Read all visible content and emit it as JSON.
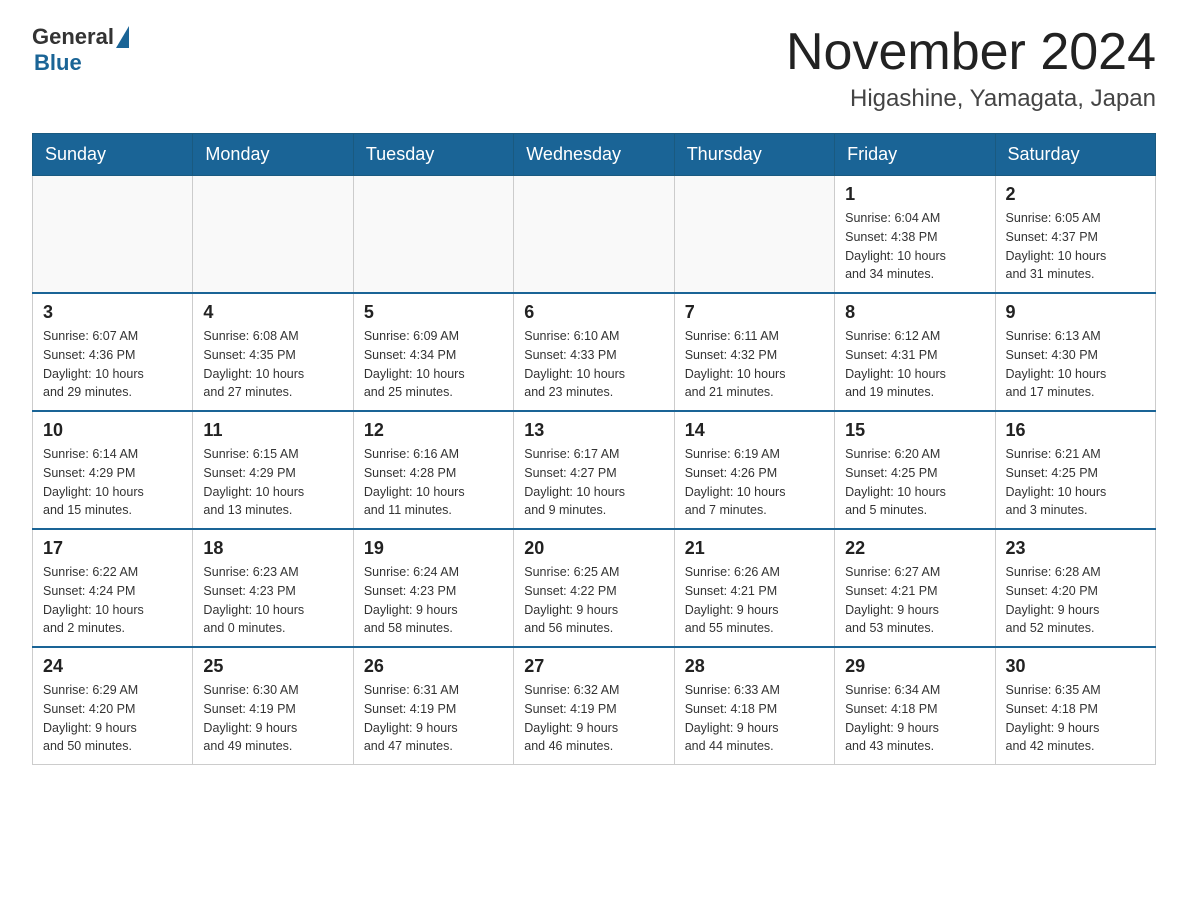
{
  "header": {
    "logo_general": "General",
    "logo_blue": "Blue",
    "title": "November 2024",
    "subtitle": "Higashine, Yamagata, Japan"
  },
  "days_of_week": [
    "Sunday",
    "Monday",
    "Tuesday",
    "Wednesday",
    "Thursday",
    "Friday",
    "Saturday"
  ],
  "weeks": [
    [
      {
        "day": "",
        "info": ""
      },
      {
        "day": "",
        "info": ""
      },
      {
        "day": "",
        "info": ""
      },
      {
        "day": "",
        "info": ""
      },
      {
        "day": "",
        "info": ""
      },
      {
        "day": "1",
        "info": "Sunrise: 6:04 AM\nSunset: 4:38 PM\nDaylight: 10 hours\nand 34 minutes."
      },
      {
        "day": "2",
        "info": "Sunrise: 6:05 AM\nSunset: 4:37 PM\nDaylight: 10 hours\nand 31 minutes."
      }
    ],
    [
      {
        "day": "3",
        "info": "Sunrise: 6:07 AM\nSunset: 4:36 PM\nDaylight: 10 hours\nand 29 minutes."
      },
      {
        "day": "4",
        "info": "Sunrise: 6:08 AM\nSunset: 4:35 PM\nDaylight: 10 hours\nand 27 minutes."
      },
      {
        "day": "5",
        "info": "Sunrise: 6:09 AM\nSunset: 4:34 PM\nDaylight: 10 hours\nand 25 minutes."
      },
      {
        "day": "6",
        "info": "Sunrise: 6:10 AM\nSunset: 4:33 PM\nDaylight: 10 hours\nand 23 minutes."
      },
      {
        "day": "7",
        "info": "Sunrise: 6:11 AM\nSunset: 4:32 PM\nDaylight: 10 hours\nand 21 minutes."
      },
      {
        "day": "8",
        "info": "Sunrise: 6:12 AM\nSunset: 4:31 PM\nDaylight: 10 hours\nand 19 minutes."
      },
      {
        "day": "9",
        "info": "Sunrise: 6:13 AM\nSunset: 4:30 PM\nDaylight: 10 hours\nand 17 minutes."
      }
    ],
    [
      {
        "day": "10",
        "info": "Sunrise: 6:14 AM\nSunset: 4:29 PM\nDaylight: 10 hours\nand 15 minutes."
      },
      {
        "day": "11",
        "info": "Sunrise: 6:15 AM\nSunset: 4:29 PM\nDaylight: 10 hours\nand 13 minutes."
      },
      {
        "day": "12",
        "info": "Sunrise: 6:16 AM\nSunset: 4:28 PM\nDaylight: 10 hours\nand 11 minutes."
      },
      {
        "day": "13",
        "info": "Sunrise: 6:17 AM\nSunset: 4:27 PM\nDaylight: 10 hours\nand 9 minutes."
      },
      {
        "day": "14",
        "info": "Sunrise: 6:19 AM\nSunset: 4:26 PM\nDaylight: 10 hours\nand 7 minutes."
      },
      {
        "day": "15",
        "info": "Sunrise: 6:20 AM\nSunset: 4:25 PM\nDaylight: 10 hours\nand 5 minutes."
      },
      {
        "day": "16",
        "info": "Sunrise: 6:21 AM\nSunset: 4:25 PM\nDaylight: 10 hours\nand 3 minutes."
      }
    ],
    [
      {
        "day": "17",
        "info": "Sunrise: 6:22 AM\nSunset: 4:24 PM\nDaylight: 10 hours\nand 2 minutes."
      },
      {
        "day": "18",
        "info": "Sunrise: 6:23 AM\nSunset: 4:23 PM\nDaylight: 10 hours\nand 0 minutes."
      },
      {
        "day": "19",
        "info": "Sunrise: 6:24 AM\nSunset: 4:23 PM\nDaylight: 9 hours\nand 58 minutes."
      },
      {
        "day": "20",
        "info": "Sunrise: 6:25 AM\nSunset: 4:22 PM\nDaylight: 9 hours\nand 56 minutes."
      },
      {
        "day": "21",
        "info": "Sunrise: 6:26 AM\nSunset: 4:21 PM\nDaylight: 9 hours\nand 55 minutes."
      },
      {
        "day": "22",
        "info": "Sunrise: 6:27 AM\nSunset: 4:21 PM\nDaylight: 9 hours\nand 53 minutes."
      },
      {
        "day": "23",
        "info": "Sunrise: 6:28 AM\nSunset: 4:20 PM\nDaylight: 9 hours\nand 52 minutes."
      }
    ],
    [
      {
        "day": "24",
        "info": "Sunrise: 6:29 AM\nSunset: 4:20 PM\nDaylight: 9 hours\nand 50 minutes."
      },
      {
        "day": "25",
        "info": "Sunrise: 6:30 AM\nSunset: 4:19 PM\nDaylight: 9 hours\nand 49 minutes."
      },
      {
        "day": "26",
        "info": "Sunrise: 6:31 AM\nSunset: 4:19 PM\nDaylight: 9 hours\nand 47 minutes."
      },
      {
        "day": "27",
        "info": "Sunrise: 6:32 AM\nSunset: 4:19 PM\nDaylight: 9 hours\nand 46 minutes."
      },
      {
        "day": "28",
        "info": "Sunrise: 6:33 AM\nSunset: 4:18 PM\nDaylight: 9 hours\nand 44 minutes."
      },
      {
        "day": "29",
        "info": "Sunrise: 6:34 AM\nSunset: 4:18 PM\nDaylight: 9 hours\nand 43 minutes."
      },
      {
        "day": "30",
        "info": "Sunrise: 6:35 AM\nSunset: 4:18 PM\nDaylight: 9 hours\nand 42 minutes."
      }
    ]
  ]
}
